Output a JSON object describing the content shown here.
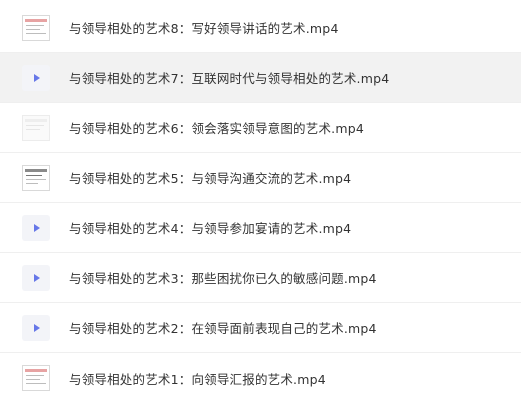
{
  "files": [
    {
      "name": "与领导相处的艺术8：写好领导讲话的艺术.mp4",
      "thumb_icon": "document-thumbnail-icon"
    },
    {
      "name": "与领导相处的艺术7：互联网时代与领导相处的艺术.mp4",
      "thumb_icon": "video-play-icon"
    },
    {
      "name": "与领导相处的艺术6：领会落实领导意图的艺术.mp4",
      "thumb_icon": "document-thumbnail-icon"
    },
    {
      "name": "与领导相处的艺术5：与领导沟通交流的艺术.mp4",
      "thumb_icon": "document-thumbnail-icon"
    },
    {
      "name": "与领导相处的艺术4：与领导参加宴请的艺术.mp4",
      "thumb_icon": "video-play-icon"
    },
    {
      "name": "与领导相处的艺术3：那些困扰你已久的敏感问题.mp4",
      "thumb_icon": "video-play-icon"
    },
    {
      "name": "与领导相处的艺术2：在领导面前表现自己的艺术.mp4",
      "thumb_icon": "video-play-icon"
    },
    {
      "name": "与领导相处的艺术1：向领导汇报的艺术.mp4",
      "thumb_icon": "document-thumbnail-icon"
    }
  ],
  "selected_index": 1,
  "colors": {
    "selected_row_bg": "#f2f2f2",
    "play_icon": "#6677e8",
    "text": "#333333"
  }
}
